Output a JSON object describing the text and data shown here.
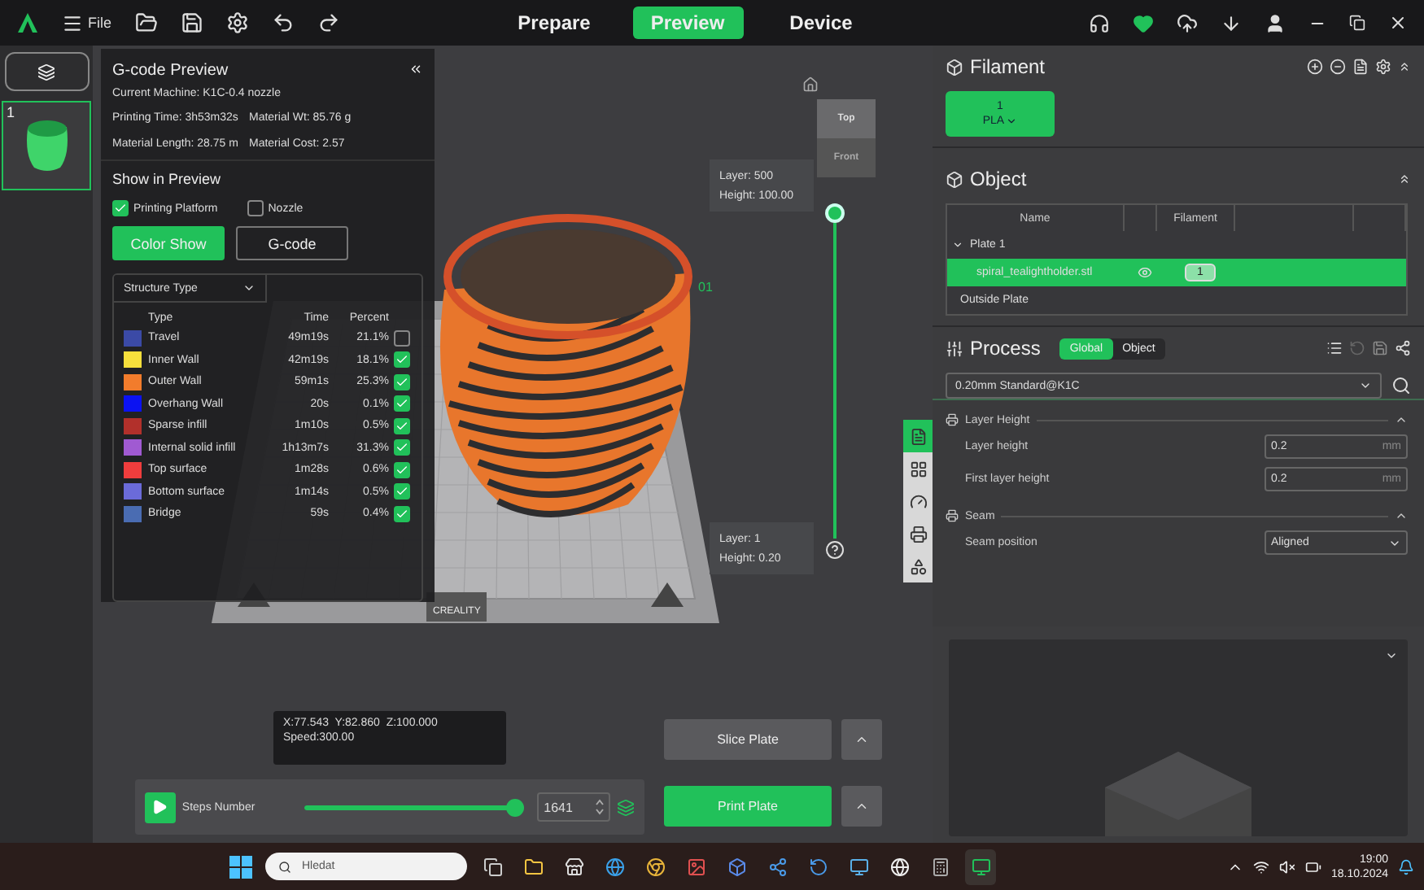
{
  "toolbar": {
    "menu_label": "File",
    "tabs": [
      {
        "label": "Prepare",
        "selected": false
      },
      {
        "label": "Preview",
        "selected": true
      },
      {
        "label": "Device",
        "selected": false
      }
    ]
  },
  "plates": [
    {
      "label": "1",
      "selected": true
    }
  ],
  "gcode_preview": {
    "title": "G-code Preview",
    "machine": "Current Machine: K1C-0.4 nozzle",
    "stats": [
      "Printing Time: 3h53m32s",
      "Material Wt: 85.76 g",
      "Material Length: 28.75 m",
      "Material Cost: 2.57"
    ],
    "show_title": "Show in Preview",
    "options": [
      {
        "label": "Printing Platform",
        "checked": true
      },
      {
        "label": "Nozzle",
        "checked": false
      }
    ],
    "modes": [
      {
        "label": "Color Show",
        "selected": true
      },
      {
        "label": "G-code",
        "selected": false
      }
    ],
    "structure_select": "Structure Type",
    "columns": [
      "Type",
      "Time",
      "Percent"
    ],
    "rows": [
      {
        "name": "Travel",
        "color": "#3b4aa6",
        "time": "49m19s",
        "percent": "21.1%",
        "checked": false
      },
      {
        "name": "Inner Wall",
        "color": "#f6df3c",
        "time": "42m19s",
        "percent": "18.1%",
        "checked": true
      },
      {
        "name": "Outer Wall",
        "color": "#f27c2c",
        "time": "59m1s",
        "percent": "25.3%",
        "checked": true
      },
      {
        "name": "Overhang Wall",
        "color": "#0b12f2",
        "time": "20s",
        "percent": "0.1%",
        "checked": true
      },
      {
        "name": "Sparse infill",
        "color": "#b2302b",
        "time": "1m10s",
        "percent": "0.5%",
        "checked": true
      },
      {
        "name": "Internal solid infill",
        "color": "#a05ad2",
        "time": "1h13m7s",
        "percent": "31.3%",
        "checked": true
      },
      {
        "name": "Top surface",
        "color": "#f03d3d",
        "time": "1m28s",
        "percent": "0.6%",
        "checked": true
      },
      {
        "name": "Bottom surface",
        "color": "#6b6bd9",
        "time": "1m14s",
        "percent": "0.5%",
        "checked": true
      },
      {
        "name": "Bridge",
        "color": "#4a6cb2",
        "time": "59s",
        "percent": "0.4%",
        "checked": true
      }
    ]
  },
  "viewport": {
    "plate_number": "01",
    "plate_brand": "CREALITY",
    "view_cube": {
      "top": "Top",
      "front": "Front"
    },
    "layer_top": {
      "layer": "Layer: 500",
      "height": "Height: 100.00"
    },
    "layer_bottom": {
      "layer": "Layer: 1",
      "height": "Height: 0.20"
    },
    "position": [
      "X:77.543  Y:82.860  Z:100.000",
      "Speed:300.00"
    ],
    "steps": {
      "label": "Steps Number",
      "level": 0.97,
      "value": "1641"
    },
    "buttons": [
      "Slice Plate",
      "Print Plate"
    ]
  },
  "filament": {
    "title": "Filament",
    "items": [
      {
        "number": "1",
        "type": "PLA"
      }
    ]
  },
  "object": {
    "title": "Object",
    "columns": [
      "Name",
      "Filament"
    ],
    "plate": {
      "name": "Plate 1",
      "expanded": true,
      "children": [
        {
          "name": "spiral_tealightholder.stl",
          "filament": "1",
          "selected": true
        }
      ]
    },
    "outside": "Outside Plate"
  },
  "process": {
    "title": "Process",
    "scopes": [
      {
        "label": "Global",
        "selected": true
      },
      {
        "label": "Object",
        "selected": false
      }
    ],
    "preset": "0.20mm Standard@K1C",
    "side_tabs": [
      {
        "selected": true
      },
      {
        "selected": false
      },
      {
        "selected": false
      },
      {
        "selected": false
      },
      {
        "selected": false
      }
    ],
    "sections": [
      {
        "title": "Layer Height",
        "params": [
          {
            "kind": "number",
            "label": "Layer height",
            "value": "0.2",
            "unit": "mm"
          },
          {
            "kind": "number",
            "label": "First layer height",
            "value": "0.2",
            "unit": "mm"
          }
        ]
      },
      {
        "title": "Seam",
        "params": [
          {
            "kind": "select",
            "label": "Seam position",
            "value": "Aligned"
          }
        ]
      }
    ]
  },
  "taskbar": {
    "search_placeholder": "Hledat",
    "time": "19:00",
    "date": "18.10.2024"
  }
}
